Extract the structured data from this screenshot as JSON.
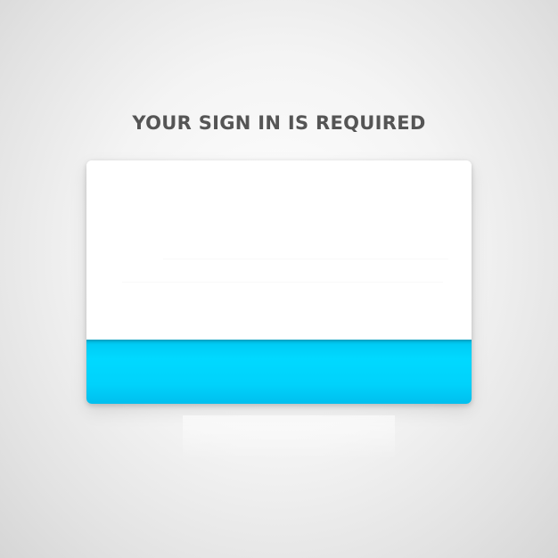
{
  "page": {
    "heading": "YOUR SIGN IN IS REQUIRED"
  },
  "card": {
    "footer_label": ""
  },
  "colors": {
    "accent": "#00d5fd",
    "heading_text": "#555555",
    "card_background": "#ffffff"
  }
}
